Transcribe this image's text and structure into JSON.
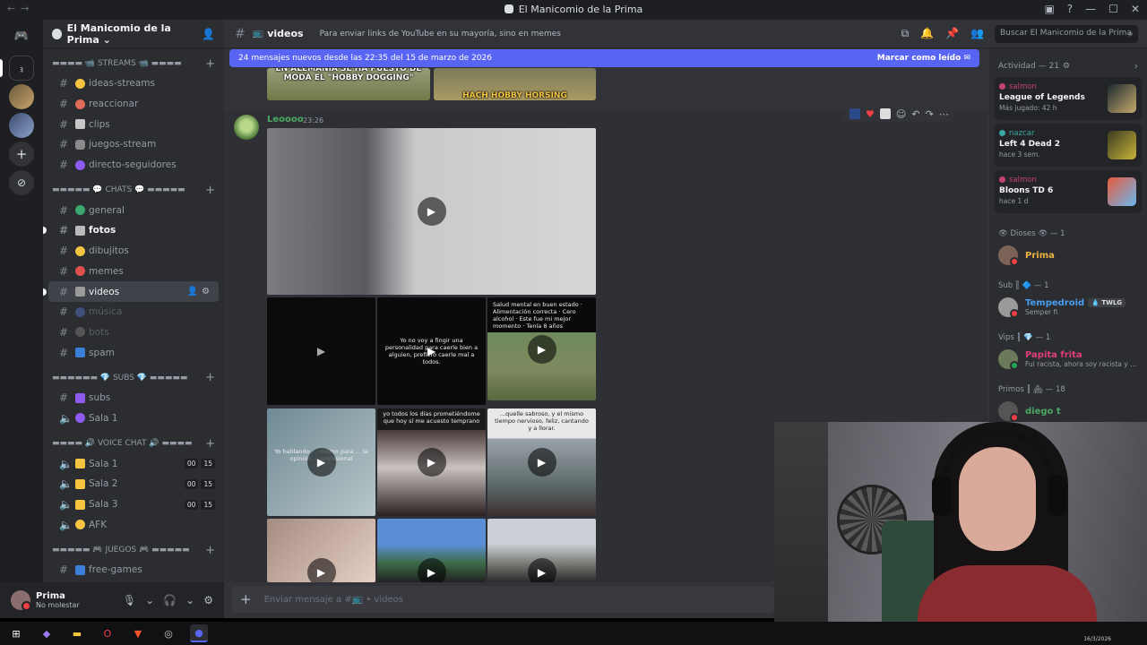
{
  "window": {
    "title": "El Manicomio de la Prima"
  },
  "rail": {
    "servers": [
      "discord-home",
      "server-a",
      "server-b",
      "server-c"
    ],
    "add_icon": "plus-icon",
    "explore_icon": "compass-icon"
  },
  "server": {
    "name": "El Manicomio de la Prima ⌄"
  },
  "sidebar": {
    "categories": {
      "streams": "▬▬▬▬ 📹 STREAMS 📹 ▬▬▬▬",
      "chats": "▬▬▬▬▬ 💬 CHATS 💬 ▬▬▬▬▬",
      "subs": "▬▬▬▬▬▬ 💎 SUBS 💎 ▬▬▬▬▬",
      "voice": "▬▬▬▬ 🔊 VOICE CHAT 🔊 ▬▬▬▬",
      "games": "▬▬▬▬▬ 🎮 JUEGOS 🎮 ▬▬▬▬▬"
    },
    "channels": {
      "ideas": "ideas-streams",
      "reaccionar": "reaccionar",
      "clips": "clips",
      "juegos_stream": "juegos-stream",
      "directo": "directo-seguidores",
      "general": "general",
      "fotos": "fotos",
      "dibujitos": "dibujitos",
      "memes": "memes",
      "videos": "videos",
      "musica": "música",
      "bots": "bots",
      "spam": "spam",
      "subs": "subs",
      "sala_sub": "Sala 1",
      "sala1": "Sala 1",
      "sala2": "Sala 2",
      "sala3": "Sala 3",
      "afk": "AFK",
      "free_games": "free-games"
    },
    "voice_counts": {
      "a": "00",
      "b": "15"
    }
  },
  "user": {
    "name": "Prima",
    "status": "No molestar"
  },
  "chat": {
    "channel": "videos",
    "topic": "Para enviar links de YouTube en su mayoría, sino en memes",
    "search_placeholder": "Buscar El Manicomio de la Prima",
    "new_messages": "24 mensajes nuevos desde las 22:35 del 15 de marzo de 2026",
    "mark_read": "Marcar como leído",
    "prev_caption_1": "EN ALEMANIA SE HA PUESTO DE MODA EL \"HOBBY DOGGING\"",
    "prev_caption_2": "HACH HOBBY HORSING",
    "author": "Leoooo",
    "time": "23:26",
    "media_text_1": "Yo no voy a fingir una personalidad para caerle bien a alguien, prefiero caerle mal a todos.",
    "media_text_2": "Salud mental en buen estado · Alimentación correcta · Cero alcohol · Este fue mi mejor momento · Tenía 8 años",
    "media_text_3": "Yo hablando ... mismo para ... la opinión ... profesional",
    "media_text_4": "yo todos los días prometiéndome que hoy sí me acuesto temprano",
    "media_text_5": "...quelle sabroso, y el mismo tiempo nervioso, feliz, cantando y a llorar.",
    "composer_placeholder": "Enviar mensaje a #📺 • videos"
  },
  "members": {
    "activity_header": "Actividad — 21",
    "activities": [
      {
        "user": "salmon",
        "game": "League of Legends",
        "when": "Más jugado: 42 h"
      },
      {
        "user": "nazcar",
        "game": "Left 4 Dead 2",
        "when": "hace 3 sem."
      },
      {
        "user": "salmon",
        "game": "Bloons TD 6",
        "when": "hace 1 d"
      }
    ],
    "roles": {
      "dioses": "👁 Dioses 👁 — 1",
      "sub": "Sub ║ 🔷 — 1",
      "vips": "Vips ║ 💎 — 1",
      "primos": "Primos ║ 🏘 — 18"
    },
    "people": {
      "prima": "Prima",
      "tempedroid": "Tempedroid",
      "tempedroid_tag": "💧 TWLG",
      "tempedroid_sub": "Semper fi",
      "papita": "Papita frita",
      "papita_sub": "Fui racista, ahora soy racista y ...",
      "diego": "diego t"
    }
  },
  "colors": {
    "accent": "#5865f2",
    "online": "#23a55a",
    "dnd": "#f23f43",
    "prima": "#e9b040",
    "tempedroid": "#4a9df0",
    "papita": "#e03e7a",
    "diego": "#4ba862"
  },
  "taskbar": {
    "clock": "16/3/2026"
  }
}
